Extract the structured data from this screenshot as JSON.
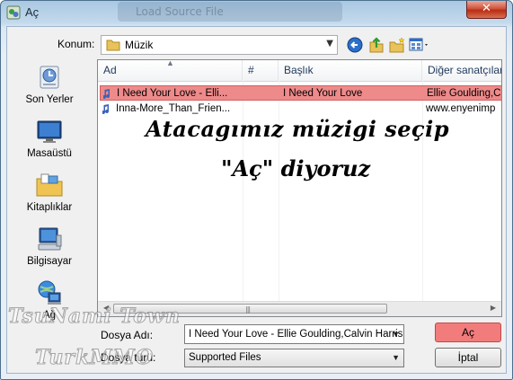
{
  "window": {
    "title": "Aç",
    "ghost_title": "Load Source File"
  },
  "location": {
    "label": "Konum:",
    "value": "Müzik"
  },
  "places": [
    {
      "label": "Son Yerler",
      "icon": "recent-places-icon"
    },
    {
      "label": "Masaüstü",
      "icon": "desktop-icon"
    },
    {
      "label": "Kitaplıklar",
      "icon": "libraries-icon"
    },
    {
      "label": "Bilgisayar",
      "icon": "computer-icon"
    },
    {
      "label": "Ağ",
      "icon": "network-icon"
    }
  ],
  "columns": [
    "Ad",
    "#",
    "Başlık",
    "Diğer sanatçılar"
  ],
  "files": [
    {
      "name": "I Need Your Love - Elli...",
      "num": "",
      "title": "I Need Your Love",
      "artists": "Ellie Goulding,C",
      "selected": true
    },
    {
      "name": "Inna-More_Than_Frien...",
      "num": "",
      "title": "",
      "artists": "www.enyenimp",
      "selected": false
    }
  ],
  "overlay": {
    "line1": "Atacagımız müzigi seçip",
    "line2": "\"Aç\" diyoruz"
  },
  "filename": {
    "label": "Dosya Adı:",
    "value": "I Need Your Love - Ellie Goulding,Calvin Harris.!"
  },
  "filetype": {
    "label": "Dosya türü:",
    "value": "Supported Files"
  },
  "buttons": {
    "open": "Aç",
    "cancel": "İptal"
  },
  "watermark": {
    "line1": "TsuNami Town",
    "line2": "TurkMMO"
  },
  "colors": {
    "selection": "#ee8a8a",
    "open_button": "#f27c7c"
  }
}
